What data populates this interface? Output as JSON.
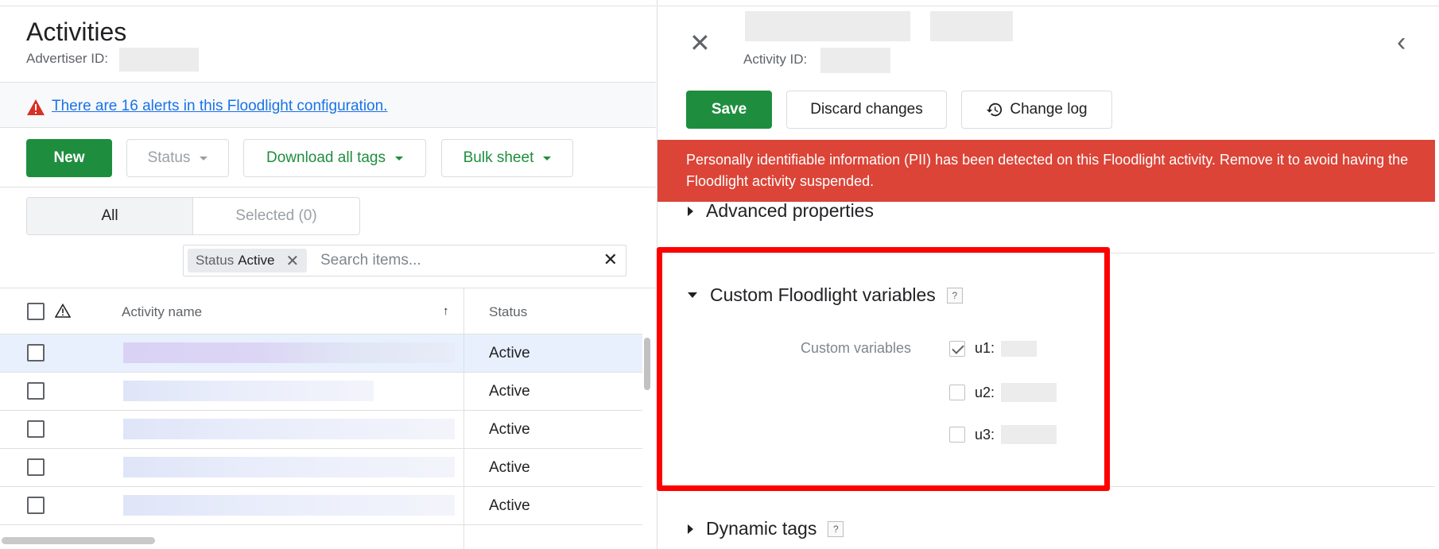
{
  "left": {
    "title": "Activities",
    "advertiser_label": "Advertiser ID:",
    "alert_text": "There are 16 alerts in this Floodlight configuration.",
    "toolbar": {
      "new_label": "New",
      "status_label": "Status",
      "download_label": "Download all tags",
      "bulk_label": "Bulk sheet"
    },
    "tabs": {
      "all_label": "All",
      "selected_label": "Selected (0)"
    },
    "filter": {
      "chip_key": "Status",
      "chip_value": "Active",
      "search_placeholder": "Search items..."
    },
    "table": {
      "col_name": "Activity name",
      "col_status": "Status",
      "sort_indicator": "↑",
      "rows": [
        {
          "status": "Active"
        },
        {
          "status": "Active"
        },
        {
          "status": "Active"
        },
        {
          "status": "Active"
        },
        {
          "status": "Active"
        }
      ]
    }
  },
  "right": {
    "activity_id_label": "Activity ID:",
    "actions": {
      "save_label": "Save",
      "discard_label": "Discard changes",
      "changelog_label": "Change log"
    },
    "pii_banner": "Personally identifiable information (PII) has been detected on this Floodlight activity. Remove it to avoid having the Floodlight activity suspended.",
    "sections": {
      "advanced": "Advanced properties",
      "custom": "Custom Floodlight variables",
      "dynamic": "Dynamic tags",
      "help_label": "?"
    },
    "custom_variables": {
      "label": "Custom variables",
      "vars": [
        {
          "name": "u1:",
          "checked": true
        },
        {
          "name": "u2:",
          "checked": false
        },
        {
          "name": "u3:",
          "checked": false
        }
      ]
    }
  },
  "colors": {
    "primary_green": "#1e8e3e",
    "link_blue": "#1a73e8",
    "alert_red": "#db4437",
    "highlight_red": "#ff0000"
  }
}
